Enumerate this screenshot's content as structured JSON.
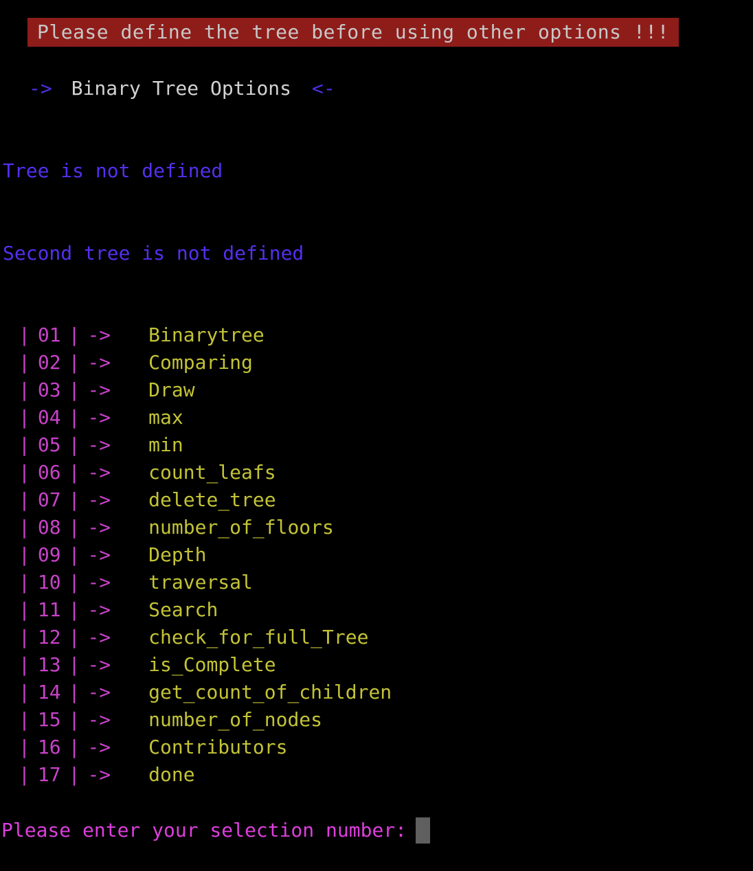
{
  "terminal": {
    "background_color": "#000000"
  },
  "banner": {
    "text": "Please define the tree before using other options !!!",
    "background_color": "#8e1d1a",
    "text_color": "#c8c8c8"
  },
  "title": {
    "left_arrow": "->",
    "text": "Binary Tree Options",
    "right_arrow": "<-",
    "arrow_color": "#4f2ee8",
    "text_color": "#d2d2d2"
  },
  "status": {
    "color": "#5430ef",
    "tree": "Tree is not defined",
    "second_tree": "Second tree is not defined"
  },
  "menu": {
    "index_color": "#c942c9",
    "label_color": "#c3c337",
    "separator": "|",
    "arrow": "->",
    "items": [
      {
        "index": "01",
        "label": "Binarytree"
      },
      {
        "index": "02",
        "label": "Comparing"
      },
      {
        "index": "03",
        "label": "Draw"
      },
      {
        "index": "04",
        "label": "max"
      },
      {
        "index": "05",
        "label": "min"
      },
      {
        "index": "06",
        "label": "count_leafs"
      },
      {
        "index": "07",
        "label": "delete_tree"
      },
      {
        "index": "08",
        "label": "number_of_floors"
      },
      {
        "index": "09",
        "label": "Depth"
      },
      {
        "index": "10",
        "label": "traversal"
      },
      {
        "index": "11",
        "label": "Search"
      },
      {
        "index": "12",
        "label": "check_for_full_Tree"
      },
      {
        "index": "13",
        "label": "is_Complete"
      },
      {
        "index": "14",
        "label": "get_count_of_children"
      },
      {
        "index": "15",
        "label": "number_of_nodes"
      },
      {
        "index": "16",
        "label": "Contributors"
      },
      {
        "index": "17",
        "label": "done"
      }
    ]
  },
  "prompt": {
    "text": "Please enter your selection number:",
    "text_color": "#dc3fdc",
    "cursor_color": "#5f5f5f",
    "input_value": ""
  }
}
